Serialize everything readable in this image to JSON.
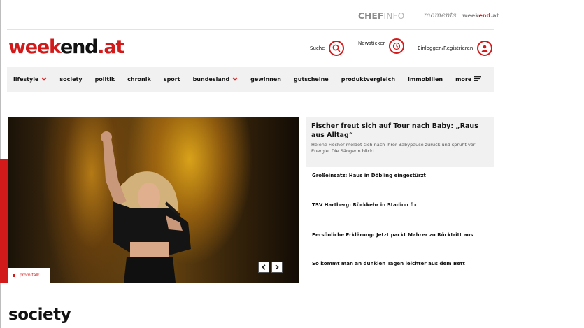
{
  "partners": {
    "chef_bold": "CHEF",
    "chef_thin": "INFO",
    "moments": "moments",
    "weekend_dark": "week",
    "weekend_accent": "end",
    "weekend_suffix": ".at"
  },
  "logo": {
    "part1": "week",
    "part2": "end",
    "part3": ".at"
  },
  "header": {
    "search_label": "Suche",
    "newsticker_label": "Newsticker",
    "login_label": "Einloggen/Registrieren"
  },
  "nav": {
    "items": [
      {
        "label": "lifestyle",
        "dropdown": true
      },
      {
        "label": "society",
        "dropdown": false
      },
      {
        "label": "politik",
        "dropdown": false
      },
      {
        "label": "chronik",
        "dropdown": false
      },
      {
        "label": "sport",
        "dropdown": false
      },
      {
        "label": "bundesland",
        "dropdown": true
      },
      {
        "label": "gewinnen",
        "dropdown": false
      },
      {
        "label": "gutscheine",
        "dropdown": false
      },
      {
        "label": "produktvergleich",
        "dropdown": false
      },
      {
        "label": "immobilien",
        "dropdown": false
      }
    ],
    "more_label": "more"
  },
  "hero": {
    "tag": "promitalk",
    "prev_icon": "chevron-left-icon",
    "next_icon": "chevron-right-icon"
  },
  "featured": {
    "title": "Fischer freut sich auf Tour nach Baby: „Raus aus Alltag“",
    "teaser": "Helene Fischer meldet sich nach ihrer Babypause zurück und sprüht vor Energie. Die Sängerin blickt..."
  },
  "headlines": [
    "Großeinsatz: Haus in Döbling eingestürzt",
    "TSV Hartberg: Rückkehr in Stadion fix",
    "Persönliche Erklärung: Jetzt packt Mahrer zu Rücktritt aus",
    "So kommt man an dunklen Tagen leichter aus dem Bett"
  ],
  "section": {
    "title": "society"
  },
  "colors": {
    "brand": "#d21a1a",
    "nav_bg": "#f1f1f1",
    "text": "#111111"
  }
}
